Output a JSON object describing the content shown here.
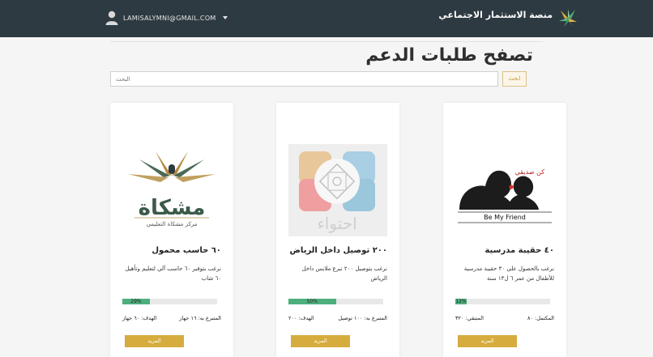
{
  "header": {
    "brand_name": "منصة الاستثمار الاجتماعي",
    "user_email": "LAMISALYMNI@GMAIL.COM",
    "brand_colors": [
      "#2e3a41",
      "#d6ac3e",
      "#4caf7d"
    ]
  },
  "page": {
    "title": "تصفح طلبات الدعم"
  },
  "search": {
    "button_label": "ابحث",
    "placeholder": "البحث"
  },
  "cards": [
    {
      "title": "٤٠ حقيبة مدرسية",
      "description": "نرغب بالحصول على ٣٠ حقيبة مدرسية للأطفال من عمر ٦ ل١٣ سنة",
      "progress": 12,
      "progress_label": "12%",
      "stat_right": "المكتمل: ٨٠",
      "stat_left": "المتبقي: ٣٢٠",
      "button": "المزيد",
      "image_caption": "Be My Friend",
      "image_caption_ar": "كن صديقي"
    },
    {
      "title": "٢٠٠ توصيل داخل الرياض",
      "description": "نرغب بتوصيل ٢٠٠ تبرع ملابس داخل الرياض",
      "progress": 50,
      "progress_label": "50%",
      "stat_right": "المتبرع به: ١٠٠ توصيل",
      "stat_left": "الهدف: ٢٠٠",
      "button": "المزيد",
      "image_caption": "احتواء"
    },
    {
      "title": "٦٠ حاسب محمول",
      "description": "نرغب بتوفير ٦٠ حاسب آلي لتعليم وتأهيل ٦٠ شاب",
      "progress": 29,
      "progress_label": "29%",
      "stat_right": "المتبرع به: ١٦ جهاز",
      "stat_left": "الهدف: ٦٠ جهاز",
      "button": "المزيد",
      "image_caption": "مشكاة",
      "image_subcaption": "مركز مشكاة التعليمي"
    }
  ]
}
